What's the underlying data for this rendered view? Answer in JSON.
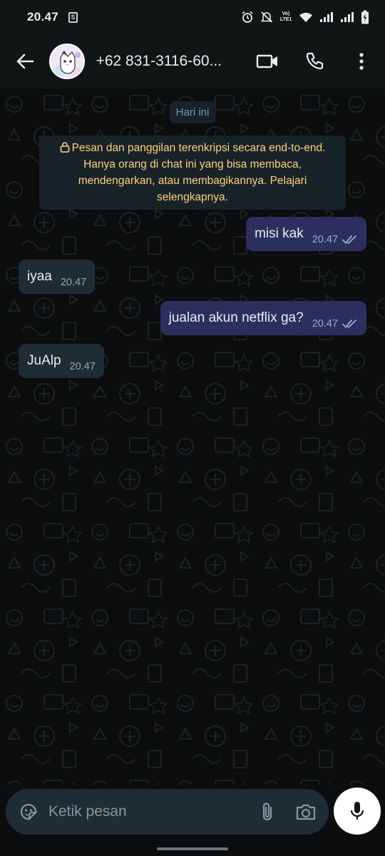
{
  "status_bar": {
    "time": "20.47",
    "notification_icon": "s-notification-icon",
    "icons": [
      "alarm-icon",
      "mute-icon",
      "volte-icon",
      "wifi-icon",
      "signal-1-icon",
      "signal-2-icon",
      "battery-charging-icon"
    ],
    "volte_label": "Vo) LTE1"
  },
  "header": {
    "contact_name": "+62 831-3116-60..."
  },
  "chat": {
    "date_label": "Hari ini",
    "encryption_notice": "Pesan dan panggilan terenkripsi secara end-to-end. Hanya orang di chat ini yang bisa membaca, mendengarkan, atau membagikannya. Pelajari selengkapnya.",
    "messages": [
      {
        "direction": "out",
        "text": "misi kak",
        "time": "20.47",
        "status": "read-ticks-icon"
      },
      {
        "direction": "in",
        "text": "iyaa",
        "time": "20.47"
      },
      {
        "direction": "out",
        "text": "jualan akun netflix ga?",
        "time": "20.47",
        "status": "read-ticks-icon"
      },
      {
        "direction": "in",
        "text": "JuAlp",
        "time": "20.47"
      }
    ]
  },
  "composer": {
    "placeholder": "Ketik pesan"
  },
  "colors": {
    "background": "#0b0d0e",
    "header": "#111516",
    "outgoing_bubble": "#2c2f5e",
    "incoming_bubble": "#1f2c33",
    "notice_text": "#ffd279",
    "mic_button": "#ffffff"
  }
}
